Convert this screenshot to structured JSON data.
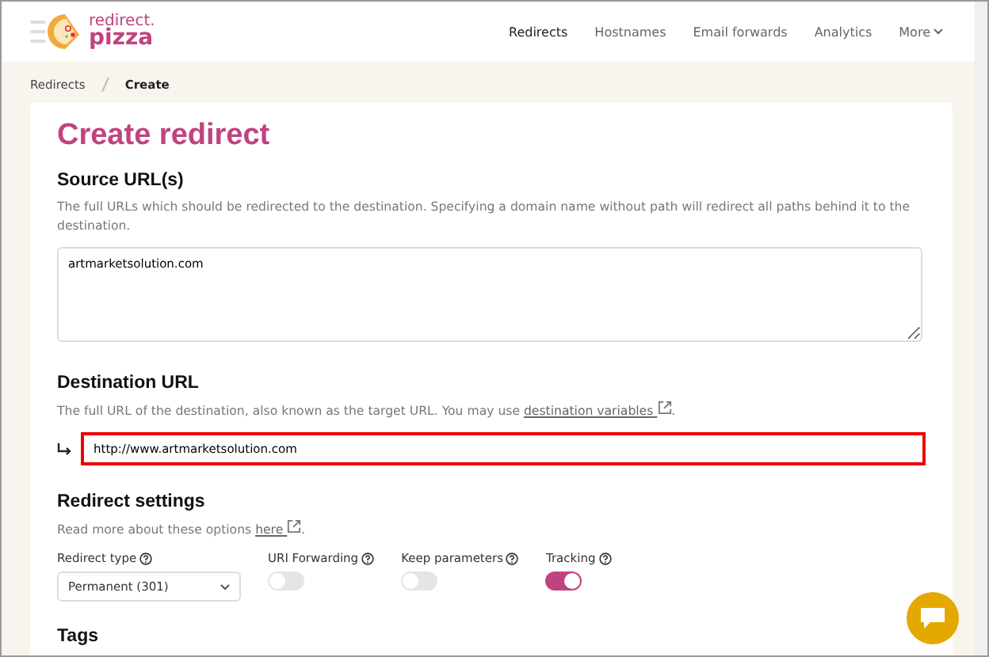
{
  "logo": {
    "line1": "redirect.",
    "line2": "pizza"
  },
  "nav": [
    {
      "label": "Redirects",
      "selected": true
    },
    {
      "label": "Hostnames",
      "selected": false
    },
    {
      "label": "Email forwards",
      "selected": false
    },
    {
      "label": "Analytics",
      "selected": false
    },
    {
      "label": "More",
      "selected": false
    }
  ],
  "breadcrumb": [
    {
      "label": "Redirects",
      "current": false
    },
    {
      "label": "Create",
      "current": true
    }
  ],
  "title": "Create redirect",
  "source": {
    "heading": "Source URL(s)",
    "description": "The full URLs which should be redirected to the destination. Specifying a domain name without path will redirect all paths behind it to the destination.",
    "value": "artmarketsolution.com"
  },
  "destination": {
    "heading": "Destination URL",
    "description": "The full URL of the destination, also known as the target URL. You may use ",
    "link": "destination variables",
    "suffix": ".",
    "value": "http://www.artmarketsolution.com",
    "error": true
  },
  "settings": {
    "heading": "Redirect settings",
    "description": "Read more about these options ",
    "link": "here",
    "suffix": ".",
    "redirect_type": {
      "label": "Redirect type",
      "value": "Permanent (301)"
    },
    "toggles": [
      {
        "label": "URI Forwarding",
        "on": false
      },
      {
        "label": "Keep parameters",
        "on": false
      },
      {
        "label": "Tracking",
        "on": true
      }
    ]
  },
  "tags": {
    "heading": "Tags"
  }
}
